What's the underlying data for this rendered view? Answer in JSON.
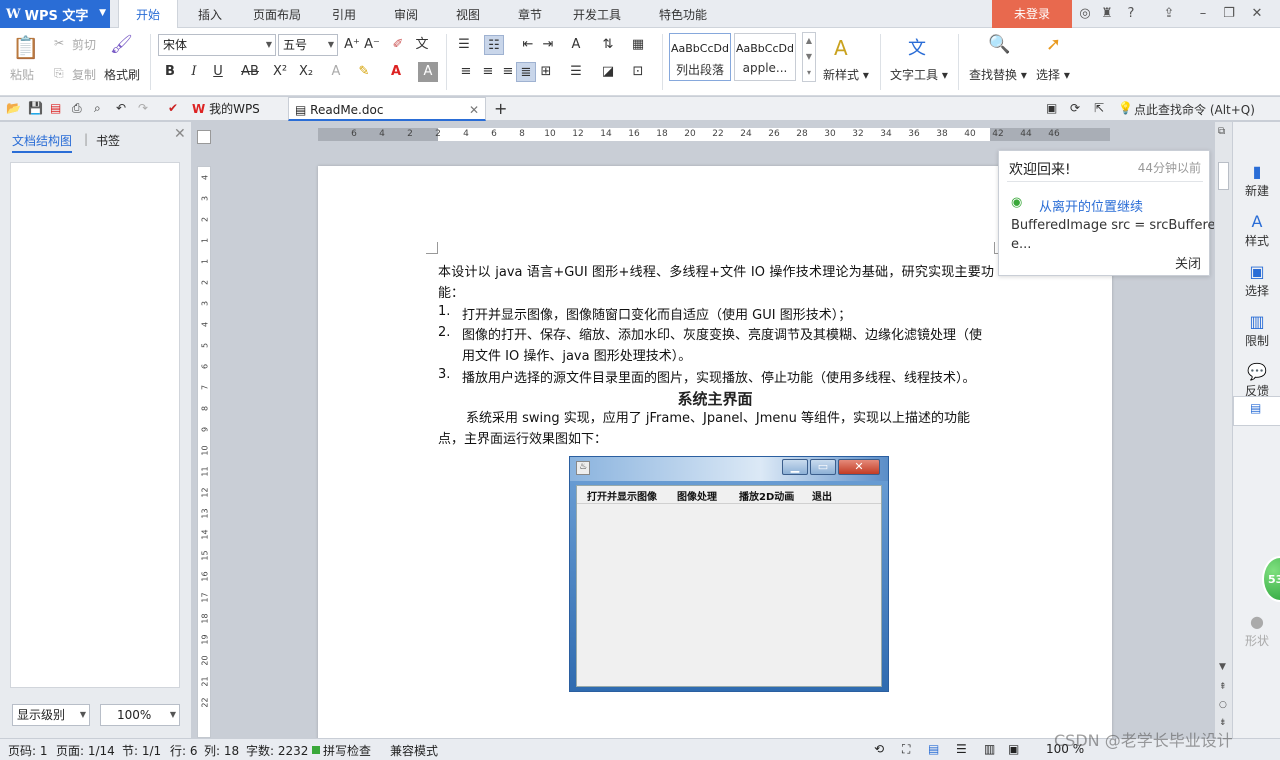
{
  "app": {
    "name": "WPS 文字",
    "menu_tabs": [
      "开始",
      "插入",
      "页面布局",
      "引用",
      "审阅",
      "视图",
      "章节",
      "开发工具",
      "特色功能"
    ],
    "login_label": "未登录"
  },
  "ribbon": {
    "paste": "粘贴",
    "cut": "剪切",
    "copy": "复制",
    "format_painter": "格式刷",
    "font_name": "宋体",
    "font_size": "五号",
    "style1_sample": "AaBbCcDd",
    "style1_name": "列出段落",
    "style2_sample": "AaBbCcDd",
    "style2_name": "apple...",
    "new_style": "新样式",
    "text_tools": "文字工具",
    "find_replace": "查找替换",
    "select": "选择"
  },
  "tabs": {
    "my_wps": "我的WPS",
    "doc": "ReadMe.doc",
    "command_search": "点此查找命令 (Alt+Q)"
  },
  "left_panel": {
    "tab_outline": "文档结构图",
    "tab_bookmark": "书签",
    "level": "显示级别",
    "zoom": "100%"
  },
  "ruler": {
    "h_ticks": [
      "6",
      "4",
      "2",
      "2",
      "4",
      "6",
      "8",
      "10",
      "12",
      "14",
      "16",
      "18",
      "20",
      "22",
      "24",
      "26",
      "28",
      "30",
      "32",
      "34",
      "36",
      "38",
      "40",
      "42",
      "44",
      "46"
    ],
    "v_ticks": [
      "4",
      "3",
      "2",
      "1",
      "1",
      "2",
      "3",
      "4",
      "5",
      "6",
      "7",
      "8",
      "9",
      "10",
      "11",
      "12",
      "13",
      "14",
      "15",
      "16",
      "17",
      "18",
      "19",
      "20",
      "21",
      "22"
    ]
  },
  "document": {
    "para1": "本设计以 java 语言+GUI 图形+线程、多线程+文件 IO 操作技术理论为基础，研究实现主要功能：",
    "list": [
      {
        "num": "1.",
        "text": "打开并显示图像，图像随窗口变化而自适应（使用 GUI 图形技术）；"
      },
      {
        "num": "2.",
        "text": "图像的打开、保存、缩放、添加水印、灰度变换、亮度调节及其模糊、边缘化滤镜处理（使用文件 IO 操作、java 图形处理技术）。"
      },
      {
        "num": "3.",
        "text": "播放用户选择的源文件目录里面的图片，实现播放、停止功能（使用多线程、线程技术）。"
      }
    ],
    "heading": "系统主界面",
    "para2": "系统采用 swing 实现，应用了 jFrame、Jpanel、Jmenu 等组件，实现以上描述的功能点，主界面运行效果图如下：",
    "java_menu": [
      "打开并显示图像",
      "图像处理",
      "播放2D动画",
      "退出"
    ]
  },
  "popup": {
    "title": "欢迎回来!",
    "time": "44分钟以前",
    "continue_link": "从离开的位置继续",
    "snippet": "BufferedImage src = srcBuffere",
    "snippet2": "e...",
    "close": "关闭"
  },
  "right_bar": [
    "新建",
    "样式",
    "选择",
    "限制",
    "反馈",
    "形状"
  ],
  "bubble_count": "53",
  "status": {
    "page": "页码: 1",
    "pages": "页面: 1/14",
    "section": "节: 1/1",
    "row": "行: 6",
    "col": "列: 18",
    "words": "字数: 2232",
    "spell": "拼写检查",
    "compat": "兼容模式",
    "zoom": "100 %"
  },
  "watermark": "CSDN @老学长毕业设计",
  "colors": {
    "accent": "#2a6dd6",
    "login": "#e8694e"
  }
}
